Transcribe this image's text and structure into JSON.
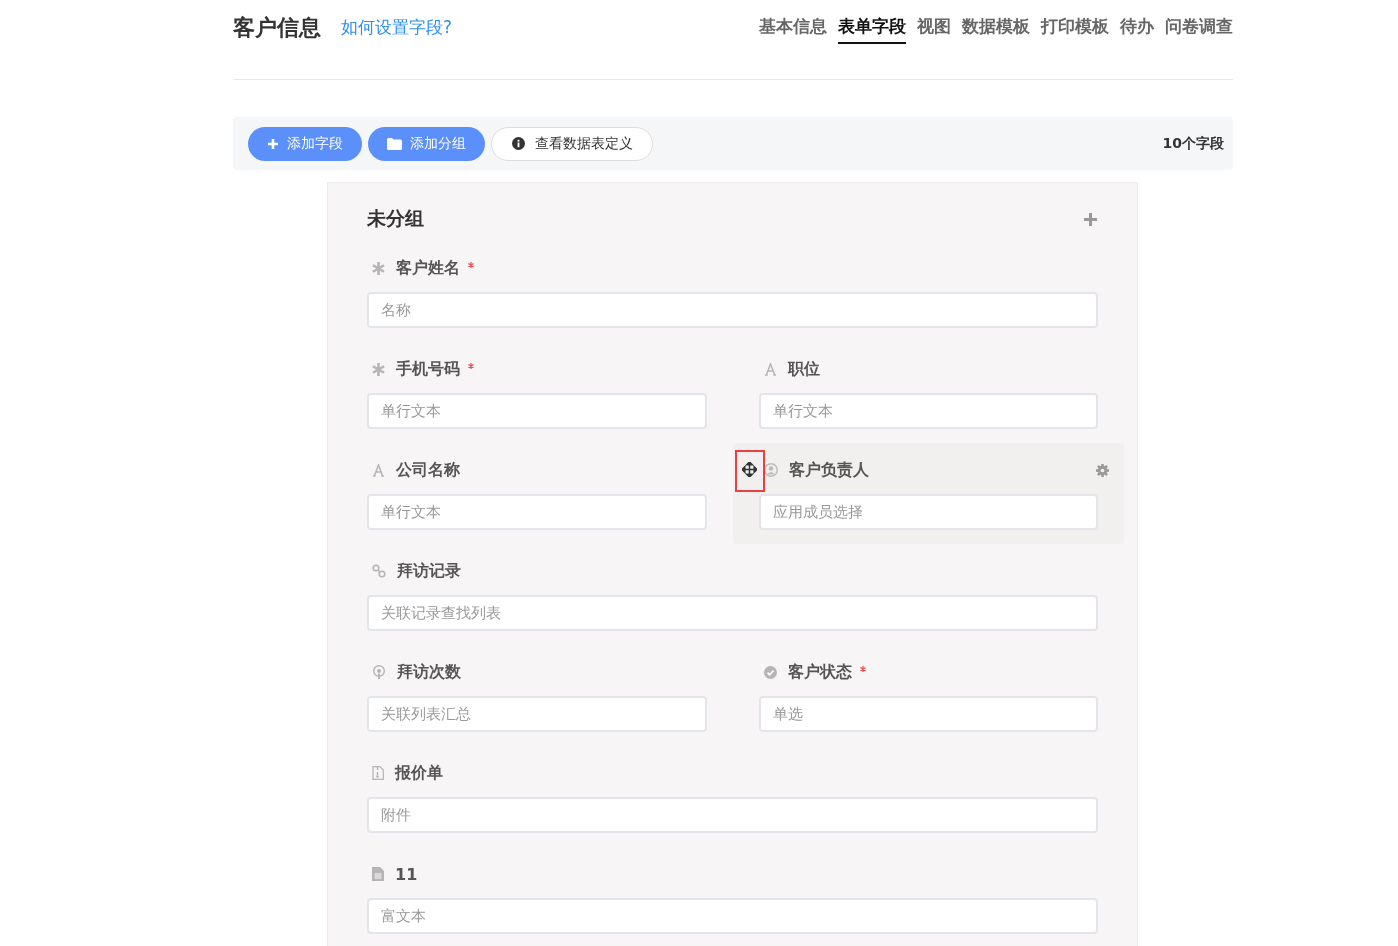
{
  "header": {
    "title": "客户信息",
    "help_link": "如何设置字段?"
  },
  "tabs": [
    {
      "label": "基本信息",
      "selected": false
    },
    {
      "label": "表单字段",
      "selected": true
    },
    {
      "label": "视图",
      "selected": false
    },
    {
      "label": "数据模板",
      "selected": false
    },
    {
      "label": "打印模板",
      "selected": false
    },
    {
      "label": "待办",
      "selected": false
    },
    {
      "label": "问卷调查",
      "selected": false
    }
  ],
  "toolbar": {
    "buttons": [
      {
        "label": "添加字段",
        "kind": "add"
      },
      {
        "label": "添加分组",
        "kind": "folder"
      },
      {
        "label": "查看数据表定义",
        "kind": "info"
      }
    ],
    "field_count": "10个字段"
  },
  "group": {
    "title": "未分组",
    "rows": [
      [
        {
          "label": "客户姓名",
          "kind": "required",
          "required": true,
          "hovered": false,
          "placeholder": "名称"
        }
      ],
      [
        {
          "label": "手机号码",
          "kind": "required",
          "required": true,
          "hovered": false,
          "placeholder": "单行文本"
        },
        {
          "label": "职位",
          "kind": "text",
          "required": false,
          "hovered": false,
          "placeholder": "单行文本"
        }
      ],
      [
        {
          "label": "公司名称",
          "kind": "text",
          "required": false,
          "hovered": false,
          "placeholder": "单行文本"
        },
        {
          "label": "客户负责人",
          "kind": "member",
          "required": false,
          "hovered": true,
          "placeholder": "应用成员选择"
        }
      ],
      [
        {
          "label": "拜访记录",
          "kind": "link",
          "required": false,
          "hovered": false,
          "placeholder": "关联记录查找列表"
        }
      ],
      [
        {
          "label": "拜访次数",
          "kind": "rollup",
          "required": false,
          "hovered": false,
          "placeholder": "关联列表汇总"
        },
        {
          "label": "客户状态",
          "kind": "select",
          "required": true,
          "hovered": false,
          "placeholder": "单选"
        }
      ],
      [
        {
          "label": "报价单",
          "kind": "attachment",
          "required": false,
          "hovered": false,
          "placeholder": "附件"
        }
      ],
      [
        {
          "label": "11",
          "kind": "richtext",
          "required": false,
          "hovered": false,
          "placeholder": "富文本"
        }
      ]
    ]
  }
}
